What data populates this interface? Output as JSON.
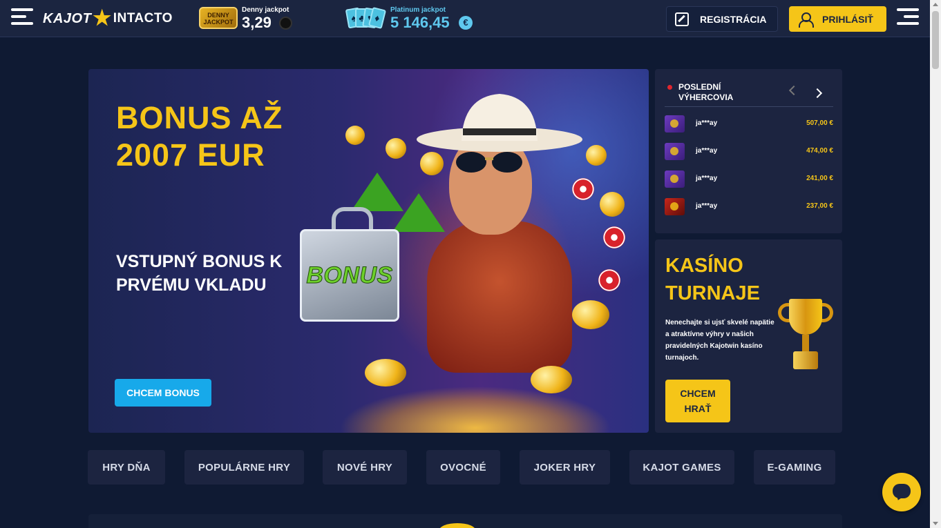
{
  "header": {
    "logo": {
      "brand": "KAJOT",
      "sub": "INTACTO"
    },
    "daily_jackpot": {
      "badge_text": "DENNY JACKPOT",
      "label": "Denny jackpot",
      "value": "3,29"
    },
    "platinum_jackpot": {
      "label": "Platinum jackpot",
      "value": "5 146,45",
      "currency": "€"
    },
    "register_label": "REGISTRÁCIA",
    "login_label": "PRIHLÁSIŤ"
  },
  "hero": {
    "title_line1": "BONUS AŽ",
    "title_line2": "2007 EUR",
    "subtitle": "VSTUPNÝ BONUS K PRVÉMU VKLADU",
    "badge": "BONUS",
    "cta_label": "CHCEM BONUS"
  },
  "winners": {
    "title": "POSLEDNÍ VÝHERCOVIA",
    "items": [
      {
        "name": "ja***ay",
        "amount": "507,00 €"
      },
      {
        "name": "ja***ay",
        "amount": "474,00 €"
      },
      {
        "name": "ja***ay",
        "amount": "241,00 €"
      },
      {
        "name": "ja***ay",
        "amount": "237,00 €"
      }
    ]
  },
  "tournaments": {
    "title_line1": "KASÍNO",
    "title_line2": "TURNAJE",
    "description": "Nenechajte si ujsť skvelé napätie a atraktívne výhry v našich pravidelných Kajotwin kasíno turnajoch.",
    "cta_line1": "CHCEM",
    "cta_line2": "HRAŤ"
  },
  "categories": [
    {
      "label": "HRY DŇA"
    },
    {
      "label": "POPULÁRNE HRY"
    },
    {
      "label": "NOVÉ HRY"
    },
    {
      "label": "OVOCNÉ"
    },
    {
      "label": "JOKER HRY"
    },
    {
      "label": "KAJOT GAMES"
    },
    {
      "label": "E-GAMING"
    }
  ],
  "colors": {
    "accent": "#f5c518",
    "info": "#17a9ea",
    "background": "#0f1a33",
    "panel": "#1c2440"
  }
}
